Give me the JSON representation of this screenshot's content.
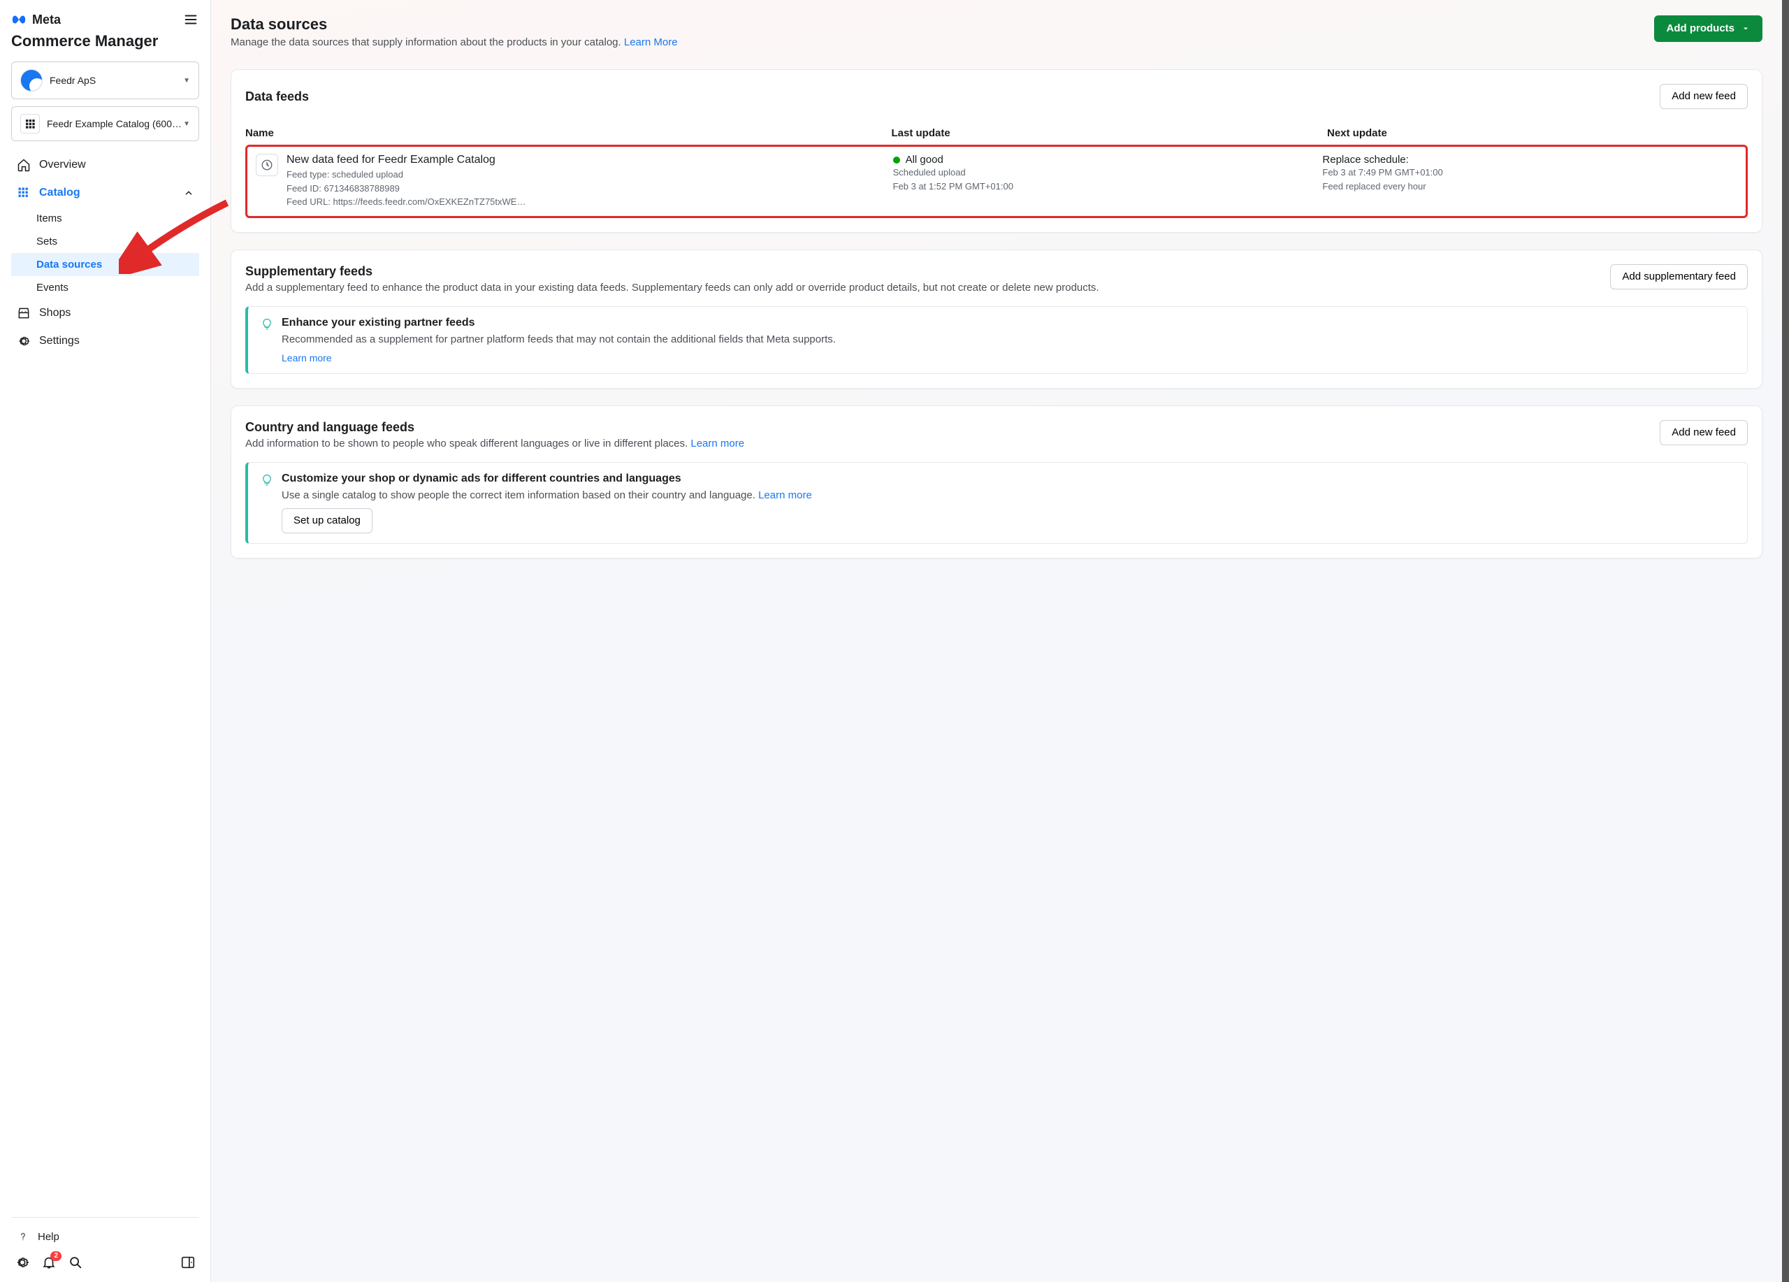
{
  "brand": {
    "company": "Meta",
    "app": "Commerce Manager"
  },
  "selectors": {
    "business": "Feedr ApS",
    "catalog": "Feedr Example Catalog (600…"
  },
  "nav": {
    "overview": "Overview",
    "catalog": "Catalog",
    "items": "Items",
    "sets": "Sets",
    "data_sources": "Data sources",
    "events": "Events",
    "shops": "Shops",
    "settings": "Settings"
  },
  "footer": {
    "help": "Help",
    "badge": "2"
  },
  "page": {
    "title": "Data sources",
    "subtitle": "Manage the data sources that supply information about the products in your catalog. ",
    "learn_more": "Learn More",
    "add_products": "Add products"
  },
  "feeds": {
    "title": "Data feeds",
    "add_btn": "Add new feed",
    "col_name": "Name",
    "col_last": "Last update",
    "col_next": "Next update",
    "row": {
      "title": "New data feed for Feedr Example Catalog",
      "type_line": "Feed type: scheduled upload",
      "id_line": "Feed ID: 671346838788989",
      "url_line": "Feed URL: https://feeds.feedr.com/OxEXKEZnTZ75txWE…",
      "status": "All good",
      "status_sub1": "Scheduled upload",
      "status_sub2": "Feb 3 at 1:52 PM GMT+01:00",
      "next1": "Replace schedule:",
      "next2": "Feb 3 at 7:49 PM GMT+01:00",
      "next3": "Feed replaced every hour"
    }
  },
  "supp": {
    "title": "Supplementary feeds",
    "desc": "Add a supplementary feed to enhance the product data in your existing data feeds. Supplementary feeds can only add or override product details, but not create or delete new products.",
    "btn": "Add supplementary feed",
    "tip_title": "Enhance your existing partner feeds",
    "tip_desc": "Recommended as a supplement for partner platform feeds that may not contain the additional fields that Meta supports.",
    "tip_link": "Learn more"
  },
  "country": {
    "title": "Country and language feeds",
    "desc": "Add information to be shown to people who speak different languages or live in different places. ",
    "learn_more": "Learn more",
    "btn": "Add new feed",
    "tip_title": "Customize your shop or dynamic ads for different countries and languages",
    "tip_desc": "Use a single catalog to show people the correct item information based on their country and language. ",
    "tip_link": "Learn more",
    "setup_btn": "Set up catalog"
  }
}
